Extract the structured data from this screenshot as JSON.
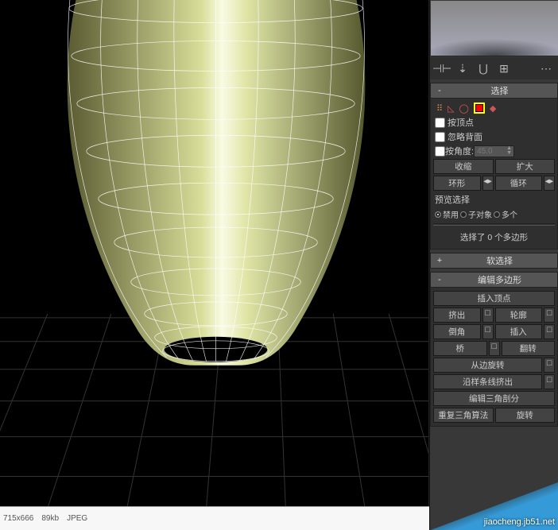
{
  "image_meta": {
    "dimensions": "715x666",
    "size": "89kb",
    "format": "JPEG"
  },
  "watermark": "jiaocheng.jb51.net",
  "panels": {
    "selection": {
      "title": "选择",
      "by_vertex": "按顶点",
      "ignore_backfacing": "忽略背面",
      "by_angle": "按角度:",
      "angle": "45.0",
      "shrink": "收缩",
      "grow": "扩大",
      "ring": "环形",
      "loop": "循环",
      "preview_sel": "预览选择",
      "radio_off": "禁用",
      "radio_sub": "子对象",
      "radio_multi": "多个",
      "sel_status": "选择了 0 个多边形"
    },
    "soft": {
      "title": "软选择"
    },
    "edit_poly": {
      "title": "编辑多边形",
      "insert_vertex": "插入顶点",
      "extrude": "挤出",
      "outline": "轮廓",
      "bevel": "倒角",
      "inset": "插入",
      "bridge": "桥",
      "flip": "翻转",
      "hinge_from_edge": "从边旋转",
      "extrude_along_spline": "沿样条线挤出",
      "edit_tri": "编辑三角剖分",
      "retriangulate": "重复三角算法",
      "turn": "旋转"
    }
  },
  "icons": {
    "sel": [
      "vertex",
      "edge",
      "border",
      "polygon",
      "element"
    ]
  }
}
